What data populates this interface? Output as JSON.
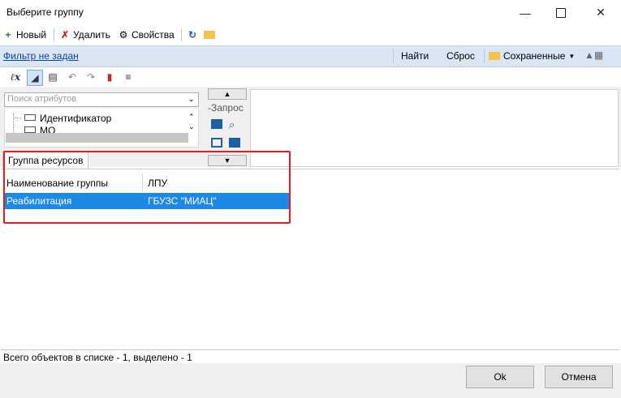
{
  "window": {
    "title": "Выберите группу",
    "minimize_icon": "minimize-icon",
    "maximize_icon": "maximize-icon",
    "close_icon": "close-icon"
  },
  "toolbar": {
    "new_label": "Новый",
    "delete_label": "Удалить",
    "properties_label": "Свойства",
    "icons": [
      "new-icon",
      "delete-icon",
      "properties-icon",
      "refresh-icon",
      "folder-icon"
    ]
  },
  "filter": {
    "status_link": "Фильтр не задан",
    "find_label": "Найти",
    "reset_label": "Сброс",
    "saved_label": "Сохраненные",
    "colors": {
      "bar": "#dae6f4",
      "link": "#0b3fa0"
    }
  },
  "query": {
    "icons": [
      "formula-icon",
      "filter-icon",
      "export-icon",
      "undo-icon",
      "redo-icon",
      "clear-filter-icon",
      "list-icon"
    ],
    "search_placeholder": "Поиск атрибутов",
    "tree_items": [
      "Идентификатор",
      "МО"
    ],
    "query_label": "-Запрос"
  },
  "tabs": [
    {
      "label": "Группа ресурсов"
    }
  ],
  "grid": {
    "columns": [
      "Наименование группы",
      "ЛПУ"
    ],
    "rows": [
      [
        "Реабилитация",
        "ГБУЗС \"МИАЦ\""
      ]
    ],
    "colors": {
      "selected_row": "#1e88e5",
      "highlight_frame": "#e11d1d"
    }
  },
  "status": {
    "text": "Всего объектов в списке - 1, выделено - 1"
  },
  "footer": {
    "ok_label": "Ok",
    "cancel_label": "Отмена"
  }
}
